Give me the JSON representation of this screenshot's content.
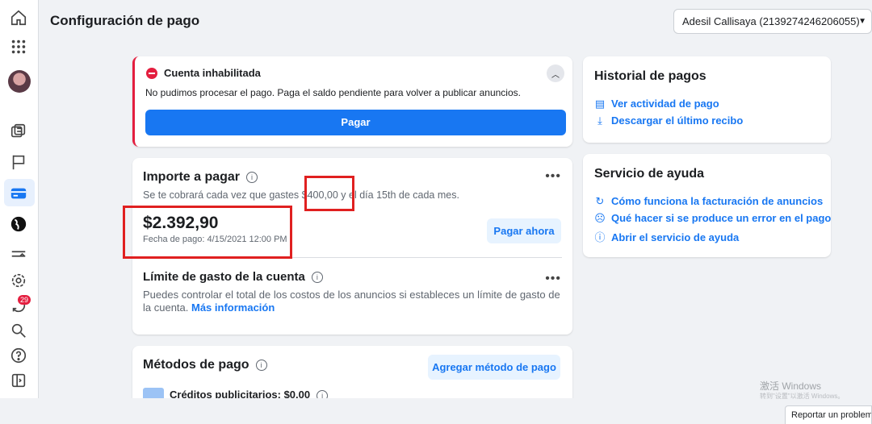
{
  "header": {
    "title": "Configuración de pago",
    "account": "Adesil Callisaya (2139274246206055)"
  },
  "sidebar": {
    "notification_count": "29"
  },
  "alert": {
    "title": "Cuenta inhabilitada",
    "message": "No pudimos procesar el pago. Paga el saldo pendiente para volver a publicar anuncios.",
    "button": "Pagar"
  },
  "amount_due": {
    "title": "Importe a pagar",
    "description": "Se te cobrará cada vez que gastes $400,00 y el día 15th de cada mes.",
    "amount": "$2.392,90",
    "due_date": "Fecha de pago: 4/15/2021 12:00 PM",
    "pay_now": "Pagar ahora"
  },
  "spending_limit": {
    "title": "Límite de gasto de la cuenta",
    "description": "Puedes controlar el total de los costos de los anuncios si estableces un límite de gasto de la cuenta.",
    "more_info": "Más información"
  },
  "payment_methods": {
    "title": "Métodos de pago",
    "add_button": "Agregar método de pago",
    "credits": "Créditos publicitarios: $0,00"
  },
  "history": {
    "title": "Historial de pagos",
    "links": [
      "Ver actividad de pago",
      "Descargar el último recibo"
    ]
  },
  "help": {
    "title": "Servicio de ayuda",
    "links": [
      "Cómo funciona la facturación de anuncios",
      "Qué hacer si se produce un error en el pago",
      "Abrir el servicio de ayuda"
    ]
  },
  "footer": {
    "report": "Reportar un problema",
    "watermark": "激活 Windows",
    "watermark_sub": "转到\"设置\"以激活 Windows。"
  },
  "colors": {
    "accent": "#1877f2",
    "alert_red": "#e41e3f",
    "annotation_red": "#e02020"
  }
}
